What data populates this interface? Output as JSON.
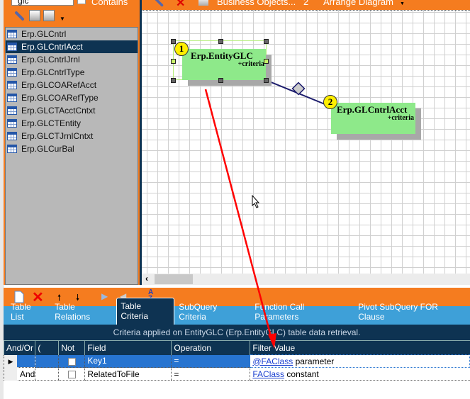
{
  "search": {
    "value": "glc",
    "match_mode": "Contains"
  },
  "tables": [
    "Erp.GLCntrl",
    "Erp.GLCntrlAcct",
    "Erp.GLCntrlJrnl",
    "Erp.GLCntrlType",
    "Erp.GLCOARefAcct",
    "Erp.GLCOARefType",
    "Erp.GLCTAcctCntxt",
    "Erp.GLCTEntity",
    "Erp.GLCTJrnlCntxt",
    "Erp.GLCurBal"
  ],
  "selected_table": "Erp.GLCntrlAcct",
  "diagram_toolbar": {
    "business_objects": "Business Objects...",
    "count": "2",
    "arrange": "Arrange Diagram"
  },
  "entities": [
    {
      "number": "1",
      "name": "Erp.EntityGLC",
      "tag": "+criteria"
    },
    {
      "number": "2",
      "name": "Erp.GLCntrlAcct",
      "tag": "+criteria"
    }
  ],
  "tabs": [
    "Table List",
    "Table Relations",
    "Table Criteria",
    "SubQuery Criteria",
    "Function Call Parameters",
    "Pivot SubQuery FOR Clause"
  ],
  "active_tab": "Table Criteria",
  "criteria": {
    "caption": "Criteria applied on EntityGLC (Erp.EntityGLC)  table data retrieval.",
    "columns": [
      "And/Or",
      "(",
      "Not",
      "Field",
      "Operation",
      "Filter Value"
    ],
    "rows": [
      {
        "andor": "",
        "paren": "",
        "not": false,
        "field": "Key1",
        "op": "=",
        "value": "@FAClass",
        "kind": "parameter"
      },
      {
        "andor": "And",
        "paren": "",
        "not": false,
        "field": "RelatedToFile",
        "op": "=",
        "value": "FAClass",
        "kind": "constant"
      }
    ]
  },
  "colors": {
    "orange": "#f57c1f",
    "navy": "#0e3352",
    "tabs": "#3ea0d8",
    "entity": "#8ee98a",
    "arrow": "#ff0000"
  }
}
